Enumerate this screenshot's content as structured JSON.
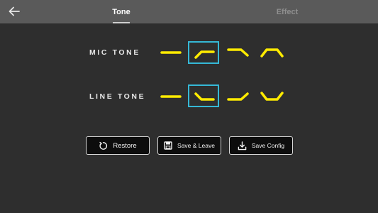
{
  "header": {
    "back_icon": "arrow-left-icon",
    "tabs": [
      {
        "label": "Tone",
        "active": true
      },
      {
        "label": "Effect",
        "active": false
      }
    ]
  },
  "tone": {
    "mic": {
      "label": "MIC TONE",
      "options": [
        "flat",
        "low-cut",
        "high-cut",
        "mid-boost"
      ],
      "selected_index": 1
    },
    "line": {
      "label": "LINE TONE",
      "options": [
        "flat",
        "low-boost",
        "high-boost",
        "mid-cut"
      ],
      "selected_index": 1
    }
  },
  "actions": {
    "restore": {
      "label": "Restore",
      "icon": "restore-icon"
    },
    "save_leave": {
      "label": "Save & Leave",
      "icon": "save-icon"
    },
    "save_config": {
      "label": "Save Config",
      "icon": "download-icon"
    }
  },
  "colors": {
    "topbar": "#5a5a5a",
    "background": "#2e2e2e",
    "curve": "#ffeb00",
    "selection": "#35b8d6"
  }
}
